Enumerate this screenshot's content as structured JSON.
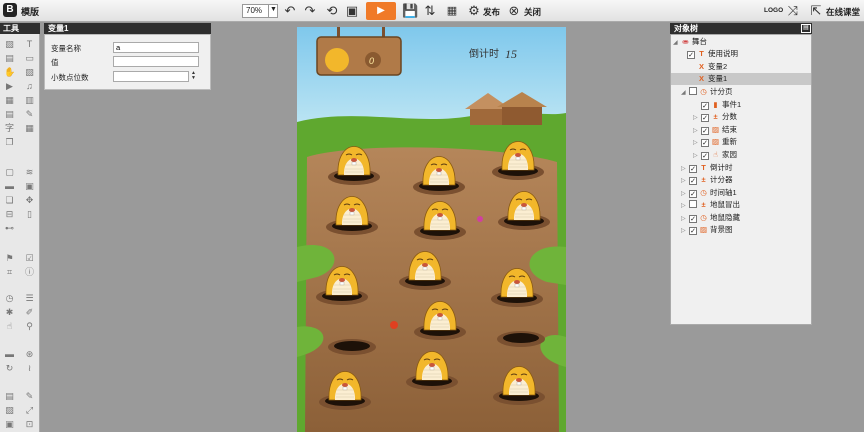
{
  "app": {
    "logo": "B",
    "name": "模版"
  },
  "toolbar": {
    "zoom": "70%",
    "publish": "发布",
    "close": "关闭",
    "logo_label": "LOGO",
    "online": "在线课堂"
  },
  "tools_panel": {
    "title": "工具"
  },
  "variable_panel": {
    "title": "变量1",
    "fields": [
      {
        "label": "变量名称",
        "value": "a"
      },
      {
        "label": "值",
        "value": ""
      },
      {
        "label": "小数点位数",
        "value": ""
      }
    ]
  },
  "stage": {
    "countdown_label": "倒计时",
    "countdown_value": "15",
    "score": "0"
  },
  "object_tree": {
    "title": "对象树",
    "items": [
      {
        "label": "舞台",
        "icon": "stage-icon"
      },
      {
        "label": "使用说明",
        "icon": "text-icon"
      },
      {
        "label": "变量2",
        "icon": "variable-icon"
      },
      {
        "label": "变量1",
        "icon": "variable-icon"
      },
      {
        "label": "计分页",
        "icon": "timer-icon"
      },
      {
        "label": "事件1",
        "icon": "event-icon"
      },
      {
        "label": "分数",
        "icon": "counter-icon"
      },
      {
        "label": "结束",
        "icon": "image-icon"
      },
      {
        "label": "重新",
        "icon": "image-icon"
      },
      {
        "label": "家园",
        "icon": "hand-icon"
      },
      {
        "label": "倒计时",
        "icon": "text-icon"
      },
      {
        "label": "计分器",
        "icon": "counter-icon"
      },
      {
        "label": "时间轴1",
        "icon": "timer-icon"
      },
      {
        "label": "地鼠冒出",
        "icon": "counter-icon"
      },
      {
        "label": "地鼠隐藏",
        "icon": "timer-icon"
      },
      {
        "label": "背景图",
        "icon": "image-icon"
      }
    ]
  }
}
